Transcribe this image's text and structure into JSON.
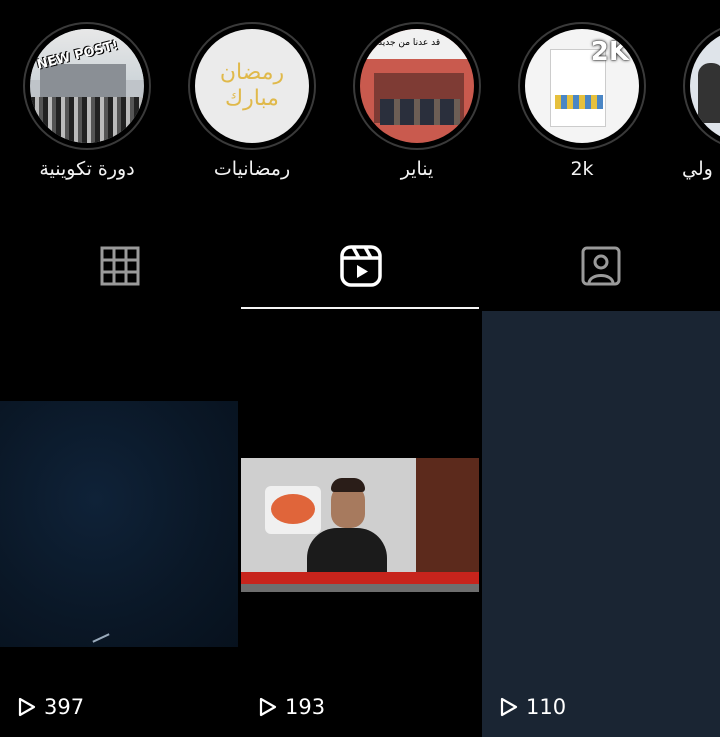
{
  "highlights": [
    {
      "label": "دورة تكوينية",
      "cover_text": "NEW POST!"
    },
    {
      "label": "رمضانيات",
      "cover_text": "رمضان مبارك"
    },
    {
      "label": "يناير",
      "cover_text": "قد عدنا من جديد"
    },
    {
      "label": "2k",
      "cover_text": "2K"
    },
    {
      "label": "ولي"
    }
  ],
  "tabs": [
    {
      "name": "posts",
      "icon": "grid-icon",
      "active": false
    },
    {
      "name": "reels",
      "icon": "reels-icon",
      "active": true
    },
    {
      "name": "tagged",
      "icon": "tagged-icon",
      "active": false
    }
  ],
  "reels": [
    {
      "views": "397"
    },
    {
      "views": "193"
    },
    {
      "views": "110"
    }
  ],
  "colors": {
    "background": "#000000",
    "text": "#ffffff",
    "ring": "#3a3a3a",
    "active_tab": "#f5f5f5"
  }
}
